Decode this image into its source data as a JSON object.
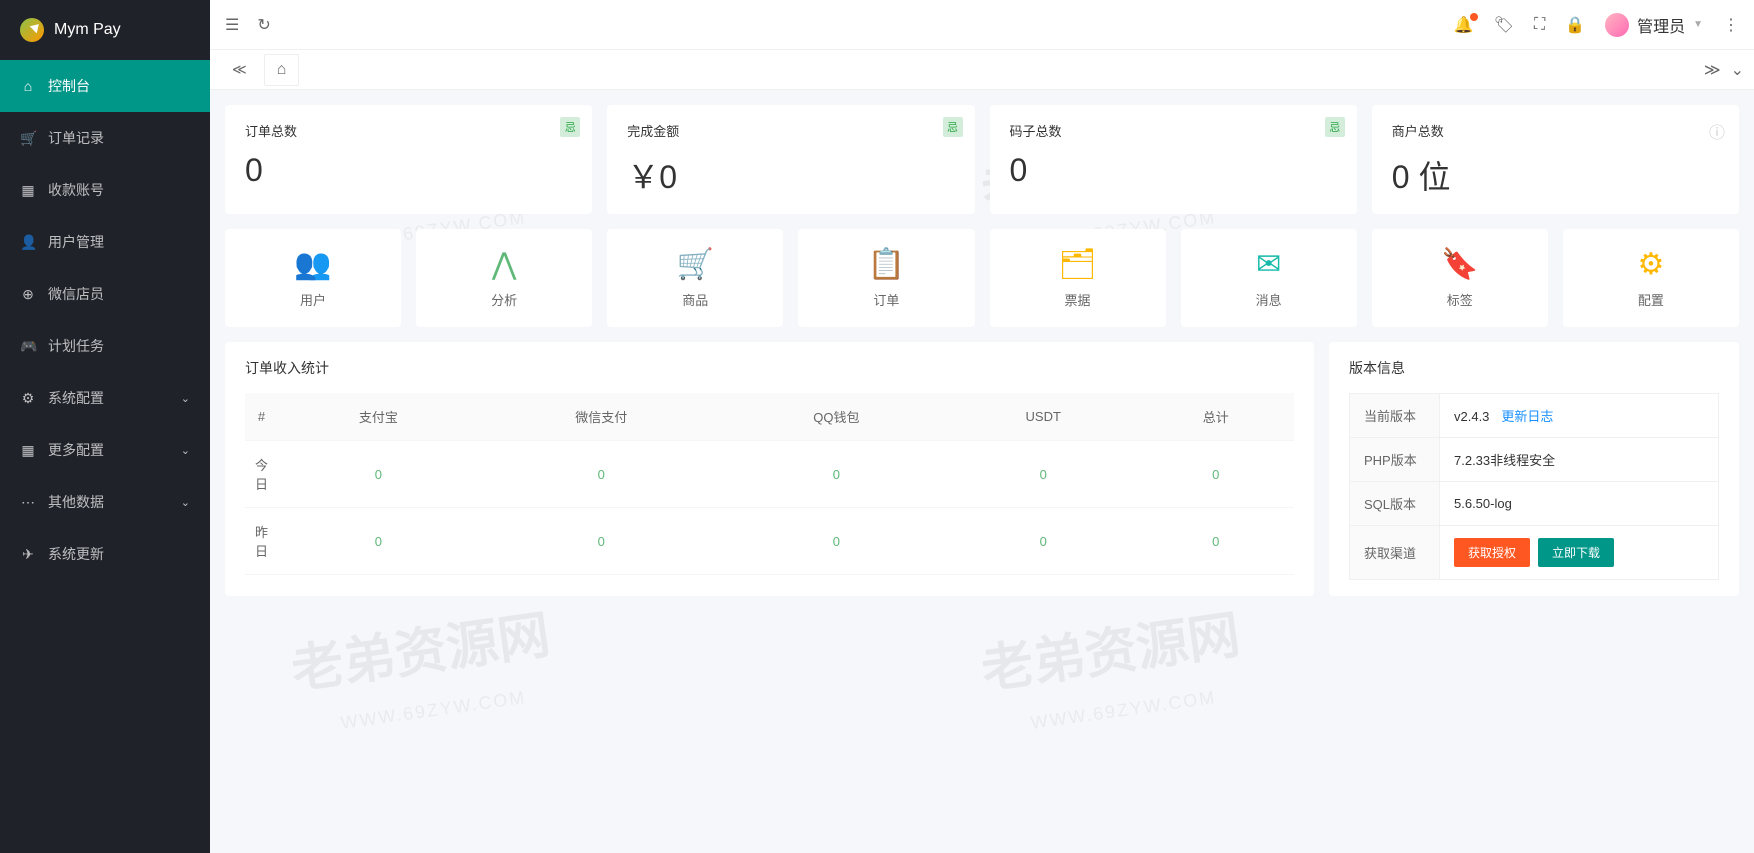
{
  "brand": "Mym Pay",
  "user_label": "管理员",
  "sidebar": [
    {
      "label": "控制台",
      "active": true
    },
    {
      "label": "订单记录"
    },
    {
      "label": "收款账号"
    },
    {
      "label": "用户管理"
    },
    {
      "label": "微信店员"
    },
    {
      "label": "计划任务"
    },
    {
      "label": "系统配置",
      "expand": true
    },
    {
      "label": "更多配置",
      "expand": true
    },
    {
      "label": "其他数据",
      "expand": true
    },
    {
      "label": "系统更新"
    }
  ],
  "stats": [
    {
      "title": "订单总数",
      "value": "0",
      "badge": "忌"
    },
    {
      "title": "完成金额",
      "value": "￥0",
      "badge": "忌"
    },
    {
      "title": "码子总数",
      "value": "0",
      "badge": "忌"
    },
    {
      "title": "商户总数",
      "value": "0 位",
      "info": true
    }
  ],
  "quick": [
    {
      "label": "用户",
      "color": "ic-teal",
      "glyph": "👥"
    },
    {
      "label": "分析",
      "color": "ic-green",
      "glyph": "⋀"
    },
    {
      "label": "商品",
      "color": "ic-orange",
      "glyph": "🛒"
    },
    {
      "label": "订单",
      "color": "ic-teal",
      "glyph": "📋"
    },
    {
      "label": "票据",
      "color": "ic-orange",
      "glyph": "🗂"
    },
    {
      "label": "消息",
      "color": "ic-teal",
      "glyph": "✉"
    },
    {
      "label": "标签",
      "color": "ic-orange",
      "glyph": "🔖"
    },
    {
      "label": "配置",
      "color": "ic-orange",
      "glyph": "⚙"
    }
  ],
  "income": {
    "title": "订单收入统计",
    "headers": [
      "#",
      "支付宝",
      "微信支付",
      "QQ钱包",
      "USDT",
      "总计"
    ],
    "rows": [
      {
        "label": "今日",
        "cells": [
          "0",
          "0",
          "0",
          "0",
          "0"
        ]
      },
      {
        "label": "昨日",
        "cells": [
          "0",
          "0",
          "0",
          "0",
          "0"
        ]
      }
    ]
  },
  "version_panel": {
    "title": "版本信息",
    "rows": [
      {
        "key": "当前版本",
        "value": "v2.4.3",
        "link": "更新日志"
      },
      {
        "key": "PHP版本",
        "value": "7.2.33非线程安全"
      },
      {
        "key": "SQL版本",
        "value": "5.6.50-log"
      }
    ],
    "action_key": "获取渠道",
    "btn1": "获取授权",
    "btn2": "立即下载"
  },
  "watermark": {
    "main": "老弟资源网",
    "sub": "WWW.69ZYW.COM"
  }
}
